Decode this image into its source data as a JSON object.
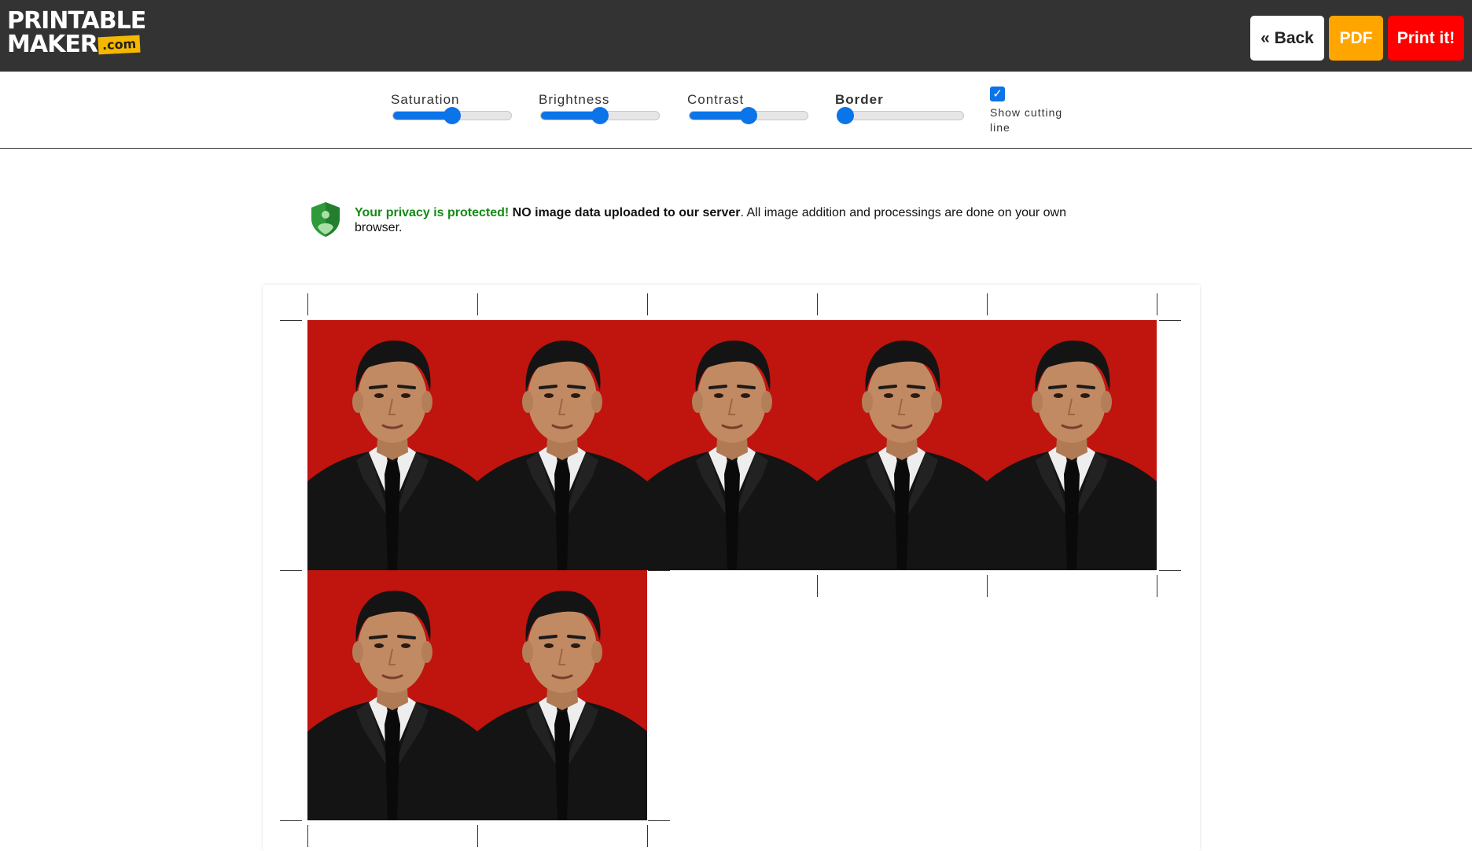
{
  "logo": {
    "line1": "PRINTABLE",
    "line2": "MAKER",
    "suffix": ".com"
  },
  "header": {
    "back_label": "« Back",
    "pdf_label": "PDF",
    "print_label": "Print it!"
  },
  "controls": {
    "saturation": {
      "label": "Saturation",
      "value": 0.5
    },
    "brightness": {
      "label": "Brightness",
      "value": 0.5
    },
    "contrast": {
      "label": "Contrast",
      "value": 0.5
    },
    "border": {
      "label": "Border",
      "value": 0.0
    },
    "cutting_line": {
      "label": "Show cutting line",
      "checked": true
    }
  },
  "privacy": {
    "highlight": "Your privacy is protected!",
    "bold": "NO image data uploaded to our server",
    "rest": ". All image addition and processings are done on your own browser."
  },
  "photos": {
    "count": 7,
    "background_color": "#c0140f"
  },
  "colors": {
    "header_bg": "#333333",
    "accent_blue": "#0b74e8",
    "pdf_orange": "#ffa500",
    "print_red": "#ff0000",
    "privacy_green": "#148a14"
  }
}
